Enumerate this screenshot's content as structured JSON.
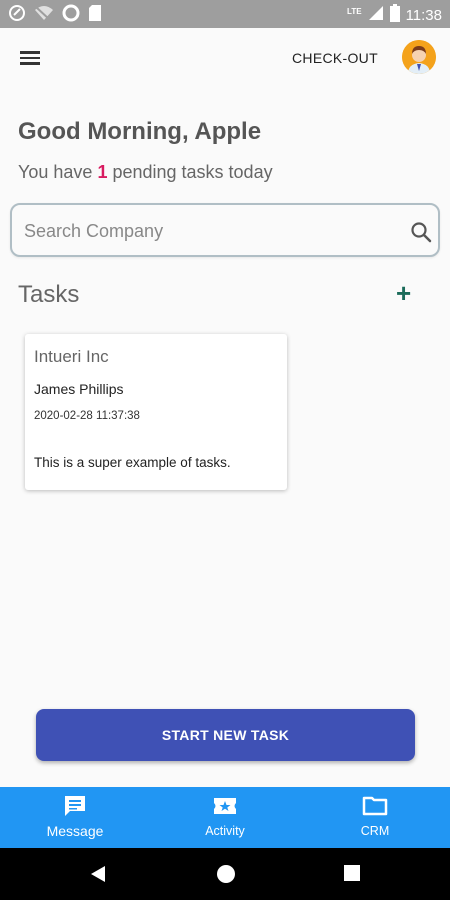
{
  "status_bar": {
    "time": "11:38",
    "network": "LTE"
  },
  "header": {
    "checkout_label": "CHECK-OUT"
  },
  "greeting": {
    "title": "Good Morning, Apple",
    "pending_prefix": "You have",
    "pending_count": "1",
    "pending_suffix": "pending tasks today"
  },
  "search": {
    "placeholder": "Search Company"
  },
  "tasks": {
    "title": "Tasks",
    "add_label": "+",
    "items": [
      {
        "company": "Intueri Inc",
        "person": "James Phillips",
        "datetime": "2020-02-28 11:37:38",
        "description": "This is a super example of tasks."
      }
    ]
  },
  "start_button_label": "START NEW TASK",
  "bottom_nav": {
    "items": [
      {
        "label": "Message",
        "icon": "message-icon"
      },
      {
        "label": "Activity",
        "icon": "ticket-icon"
      },
      {
        "label": "CRM",
        "icon": "folder-icon"
      }
    ]
  },
  "colors": {
    "primary": "#3f51b5",
    "nav": "#2196f3",
    "accent_count": "#d81b60",
    "add": "#1b6b5a"
  }
}
